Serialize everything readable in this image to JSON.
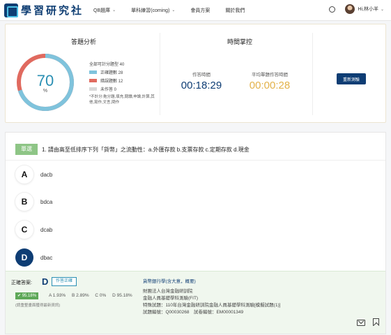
{
  "header": {
    "logo_text": "學習研究社",
    "nav": [
      {
        "label": "QB題庫",
        "has_dropdown": true
      },
      {
        "label": "單科練習(coming)",
        "has_dropdown": true
      },
      {
        "label": "會員方案",
        "has_dropdown": false
      },
      {
        "label": "關於我們",
        "has_dropdown": false
      }
    ],
    "user_name": "Hi,林小羊",
    "search_icon": "search-icon",
    "avatar_icon": "user-avatar"
  },
  "stats": {
    "analysis_title": "答題分析",
    "score": "70",
    "score_unit": "%",
    "total_label": "全部可計分題型 40",
    "legend": [
      {
        "label": "正確題數 28",
        "count": 28,
        "color": "#7fc3dc"
      },
      {
        "label": "錯誤題數 12",
        "count": 12,
        "color": "#e06a5f"
      },
      {
        "label": "未作答 0",
        "count": 0,
        "color": "#d8d8d8"
      }
    ],
    "note": "*不計分:拖分題,填充,閱讀,申論,計算,其他,寫作,文言,問作",
    "time_title": "時間掌控",
    "answer_time_label": "作答時間",
    "answer_time_value": "00:18:29",
    "answer_time_color": "#0e3d74",
    "avg_time_label": "平均單題作答時間",
    "avg_time_value": "00:00:28",
    "avg_time_color": "#e3b24a",
    "retest_button": "重新測驗"
  },
  "question": {
    "type_badge": "單選",
    "text": "1. 請由高至低排序下列「貨幣」之流動性：a.外匯存款 b.支票存款 c.定期存款 d.現金",
    "options": [
      {
        "letter": "A",
        "text": "dacb",
        "correct": false
      },
      {
        "letter": "B",
        "text": "bdca",
        "correct": false
      },
      {
        "letter": "C",
        "text": "dcab",
        "correct": false
      },
      {
        "letter": "D",
        "text": "dbac",
        "correct": true
      }
    ]
  },
  "answer": {
    "label": "正確答案:",
    "letter": "D",
    "flag_button": "作答正確",
    "correct_rate": "95.18%",
    "distribution": [
      "A 1.93%",
      "B 2.89%",
      "C 0%",
      "D 95.18%"
    ],
    "tip": "(請重整畫面獲得最新資訊)",
    "meta_title": "貨幣銀行學(含大意，概要)",
    "meta_lines": [
      "財團法人台灣金融研訓院",
      "金融人員基礎學科測驗(FIT)",
      "特殊試題：110年台灣金融研訓院金融人員基礎學科測驗[模擬試題(1)]",
      "試題編號：Q00030268　試卷編號：EM00001349"
    ]
  }
}
